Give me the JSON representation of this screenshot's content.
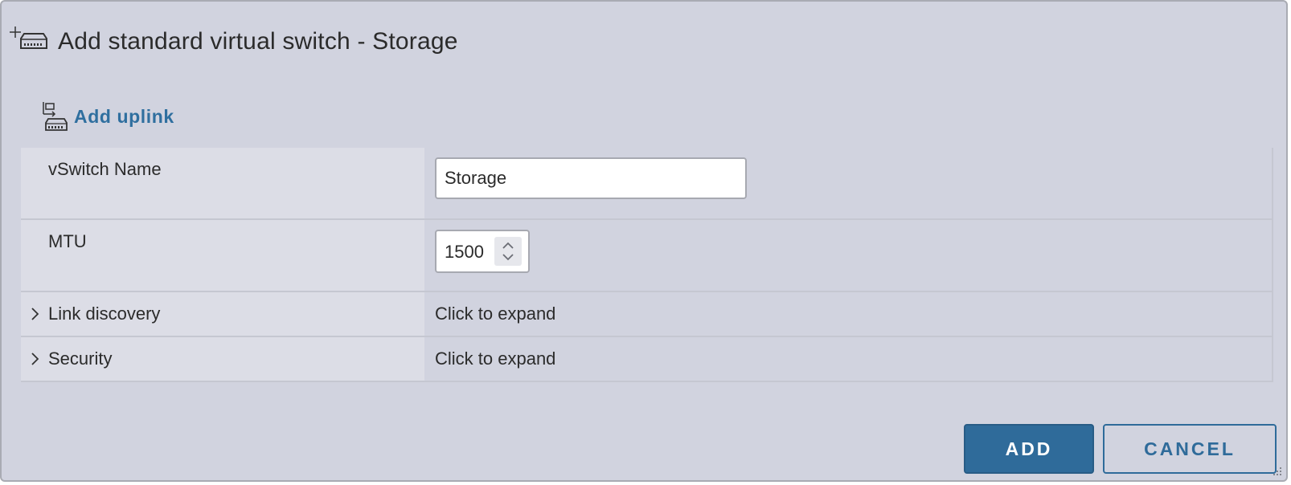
{
  "dialog": {
    "title": "Add standard virtual switch - Storage",
    "icon": "add-vswitch-icon"
  },
  "toolbar": {
    "add_uplink_label": "Add uplink",
    "add_uplink_icon": "uplink-icon"
  },
  "form": {
    "vswitch_name": {
      "label": "vSwitch Name",
      "value": "Storage"
    },
    "mtu": {
      "label": "MTU",
      "value": "1500"
    },
    "link_discovery": {
      "label": "Link discovery",
      "value": "Click to expand"
    },
    "security": {
      "label": "Security",
      "value": "Click to expand"
    }
  },
  "buttons": {
    "add_label": "ADD",
    "cancel_label": "CANCEL"
  },
  "colors": {
    "dialog_background": "#d1d3df",
    "label_cell_background": "#dcdde6",
    "accent_blue": "#2f6b9a",
    "link_blue": "#2f6f9f"
  }
}
